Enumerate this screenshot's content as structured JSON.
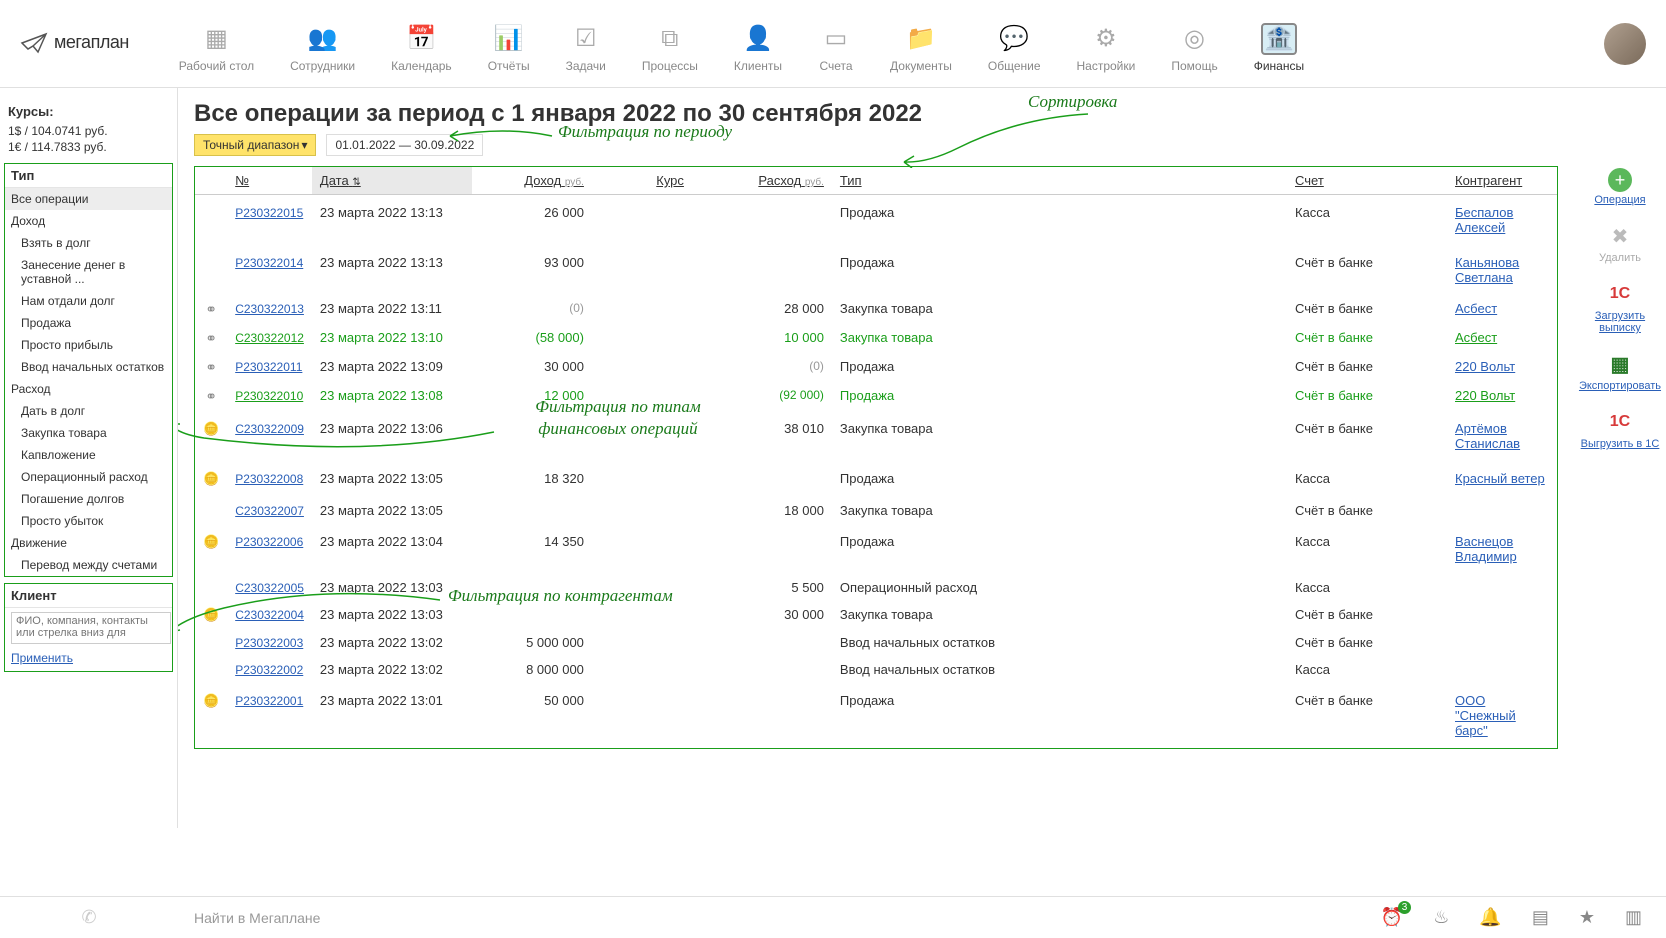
{
  "logo_text": "мегаплан",
  "nav": [
    {
      "label": "Рабочий стол"
    },
    {
      "label": "Сотрудники"
    },
    {
      "label": "Календарь"
    },
    {
      "label": "Отчёты"
    },
    {
      "label": "Задачи"
    },
    {
      "label": "Процессы"
    },
    {
      "label": "Клиенты"
    },
    {
      "label": "Счета"
    },
    {
      "label": "Документы"
    },
    {
      "label": "Общение"
    },
    {
      "label": "Настройки"
    },
    {
      "label": "Помощь"
    },
    {
      "label": "Финансы"
    }
  ],
  "rates": {
    "title": "Курсы:",
    "usd": "1$ / 104.0741 руб.",
    "eur": "1€ / 114.7833 руб."
  },
  "filter": {
    "type_label": "Тип",
    "all": "Все операции",
    "income_header": "Доход",
    "income": [
      "Взять в долг",
      "Занесение денег в уставной ...",
      "Нам отдали долг",
      "Продажа",
      "Просто прибыль",
      "Ввод начальных остатков"
    ],
    "expense_header": "Расход",
    "expense": [
      "Дать в долг",
      "Закупка товара",
      "Капвложение",
      "Операционный расход",
      "Погашение долгов",
      "Просто убыток"
    ],
    "move_header": "Движение",
    "move": [
      "Перевод между счетами"
    ]
  },
  "client": {
    "label": "Клиент",
    "placeholder": "ФИО, компания, контакты или стрелка вниз для",
    "apply": "Применить"
  },
  "page": {
    "title": "Все операции за период с 1 января 2022 по 30 сентября 2022",
    "range_btn": "Точный диапазон",
    "range_text": "01.01.2022 — 30.09.2022"
  },
  "annot": {
    "period": "Фильтрация по периоду",
    "sort": "Сортировка",
    "types": "Фильтрация по типам финансовых операций",
    "contr": "Фильтрация по контрагентам"
  },
  "cols": {
    "no": "№",
    "date": "Дата",
    "income": "Доход",
    "rub": "руб.",
    "rate": "Курс",
    "expense": "Расход",
    "type": "Тип",
    "account": "Счет",
    "contr": "Контрагент"
  },
  "rows": [
    {
      "icon": "",
      "no": "Р230322015",
      "date": "23 марта 2022 13:13",
      "in": "26 000",
      "rate": "",
      "out": "",
      "type": "Продажа",
      "acc": "Касса",
      "contr": "Беспалов Алексей",
      "g": 0
    },
    {
      "icon": "",
      "no": "Р230322014",
      "date": "23 марта 2022 13:13",
      "in": "93 000",
      "rate": "",
      "out": "",
      "type": "Продажа",
      "acc": "Счёт в банке",
      "contr": "Каньянова Светлана",
      "g": 0
    },
    {
      "icon": "link",
      "no": "С230322013",
      "date": "23 марта 2022 13:11",
      "in": "(0)",
      "rate": "",
      "out": "28 000",
      "type": "Закупка товара",
      "acc": "Счёт в банке",
      "contr": "Асбест",
      "g": 0,
      "ingray": 1
    },
    {
      "icon": "link",
      "no": "С230322012",
      "date": "23 марта 2022 13:10",
      "in": "(58 000)",
      "rate": "",
      "out": "10 000",
      "type": "Закупка товара",
      "acc": "Счёт в банке",
      "contr": "Асбест",
      "g": 1
    },
    {
      "icon": "link",
      "no": "Р230322011",
      "date": "23 марта 2022 13:09",
      "in": "30 000",
      "rate": "",
      "out": "(0)",
      "type": "Продажа",
      "acc": "Счёт в банке",
      "contr": "220 Вольт",
      "g": 0,
      "outgray": 1
    },
    {
      "icon": "link",
      "no": "Р230322010",
      "date": "23 марта 2022 13:08",
      "in": "12 000",
      "rate": "",
      "out": "(92 000)",
      "type": "Продажа",
      "acc": "Счёт в банке",
      "contr": "220 Вольт",
      "g": 1
    },
    {
      "icon": "coin",
      "no": "С230322009",
      "date": "23 марта 2022 13:06",
      "in": "",
      "rate": "",
      "out": "38 010",
      "type": "Закупка товара",
      "acc": "Счёт в банке",
      "contr": "Артёмов Станислав",
      "g": 0
    },
    {
      "icon": "coin",
      "no": "Р230322008",
      "date": "23 марта 2022 13:05",
      "in": "18 320",
      "rate": "",
      "out": "",
      "type": "Продажа",
      "acc": "Касса",
      "contr": "Красный ветер",
      "g": 0
    },
    {
      "icon": "",
      "no": "С230322007",
      "date": "23 марта 2022 13:05",
      "in": "",
      "rate": "",
      "out": "18 000",
      "type": "Закупка товара",
      "acc": "Счёт в банке",
      "contr": "",
      "g": 0
    },
    {
      "icon": "coin",
      "no": "Р230322006",
      "date": "23 марта 2022 13:04",
      "in": "14 350",
      "rate": "",
      "out": "",
      "type": "Продажа",
      "acc": "Касса",
      "contr": "Васнецов Владимир",
      "g": 0
    },
    {
      "icon": "",
      "no": "С230322005",
      "date": "23 марта 2022 13:03",
      "in": "",
      "rate": "",
      "out": "5 500",
      "type": "Операционный расход",
      "acc": "Касса",
      "contr": "",
      "g": 0
    },
    {
      "icon": "coin",
      "no": "С230322004",
      "date": "23 марта 2022 13:03",
      "in": "",
      "rate": "",
      "out": "30 000",
      "type": "Закупка товара",
      "acc": "Счёт в банке",
      "contr": "",
      "g": 0
    },
    {
      "icon": "",
      "no": "Р230322003",
      "date": "23 марта 2022 13:02",
      "in": "5 000 000",
      "rate": "",
      "out": "",
      "type": "Ввод начальных остатков",
      "acc": "Счёт в банке",
      "contr": "",
      "g": 0
    },
    {
      "icon": "",
      "no": "Р230322002",
      "date": "23 марта 2022 13:02",
      "in": "8 000 000",
      "rate": "",
      "out": "",
      "type": "Ввод начальных остатков",
      "acc": "Касса",
      "contr": "",
      "g": 0
    },
    {
      "icon": "coin",
      "no": "Р230322001",
      "date": "23 марта 2022 13:01",
      "in": "50 000",
      "rate": "",
      "out": "",
      "type": "Продажа",
      "acc": "Счёт в банке",
      "contr": "ООО \"Снежный барс\"",
      "g": 0
    }
  ],
  "actions": {
    "add": "Операция",
    "del": "Удалить",
    "load": "Загрузить выписку",
    "export": "Экспортировать",
    "upload1c": "Выгрузить в 1С"
  },
  "footer": {
    "search": "Найти в Мегаплане",
    "badge": "3"
  }
}
